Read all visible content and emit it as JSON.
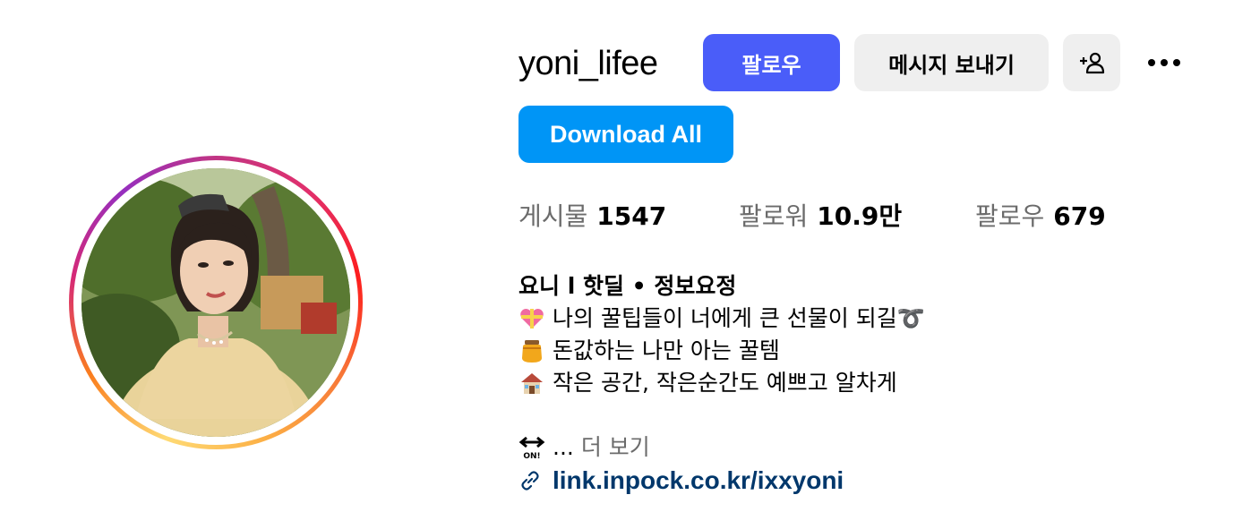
{
  "profile": {
    "username": "yoni_lifee"
  },
  "actions": {
    "follow_label": "팔로우",
    "message_label": "메시지 보내기",
    "download_label": "Download All"
  },
  "stats": {
    "posts_label": "게시물",
    "posts_value": "1547",
    "followers_label": "팔로워",
    "followers_value": "10.9만",
    "following_label": "팔로우",
    "following_value": "679"
  },
  "bio": {
    "name": "요니 l 핫딜 • 정보요정",
    "lines": [
      {
        "icon": "heart-gift-icon",
        "text": "나의 꿀팁들이 너에게 큰 선물이 되길➰"
      },
      {
        "icon": "honey-pot-icon",
        "text": "돈값하는 나만 아는 꿀템"
      },
      {
        "icon": "house-icon",
        "text": "작은 공간, 작은순간도 예쁘고 알차게"
      }
    ],
    "more_prefix": "...",
    "more_label": "더 보기",
    "link": "link.inpock.co.kr/ixxyoni"
  },
  "colors": {
    "follow_button": "#4a5df9",
    "download_button": "#0095f6",
    "secondary_button": "#efefef",
    "link": "#00376b"
  }
}
